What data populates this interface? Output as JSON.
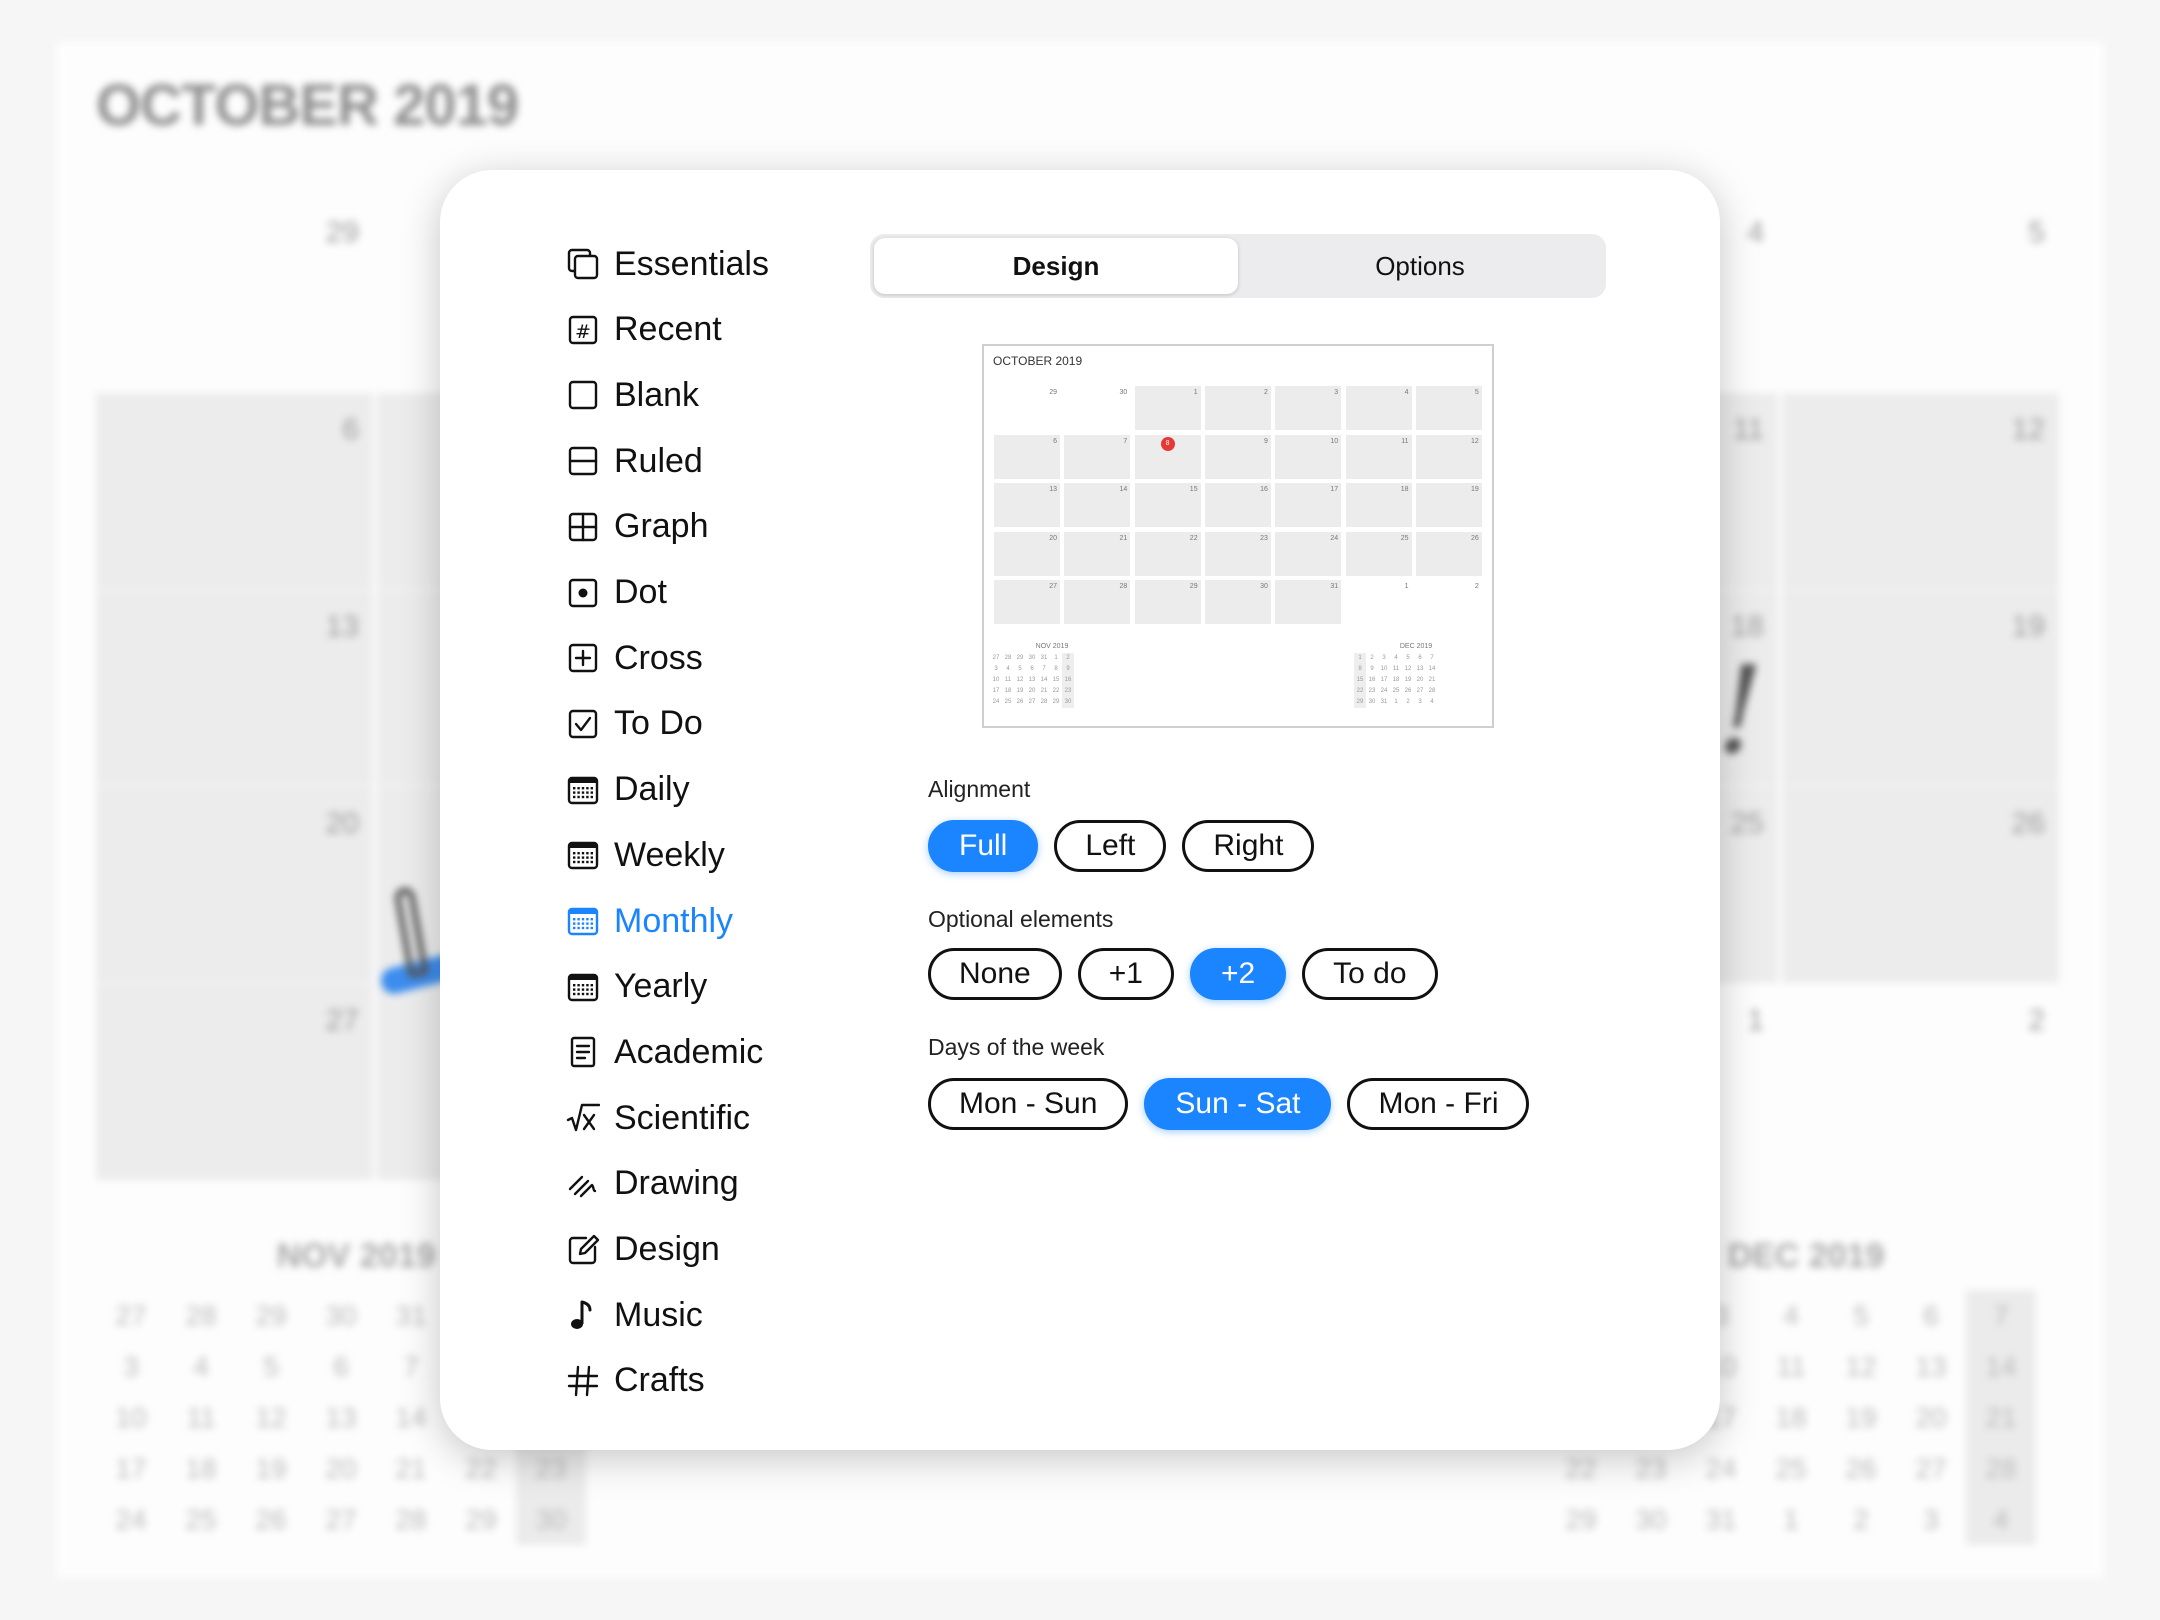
{
  "background": {
    "title": "OCTOBER 2019",
    "weeks": [
      [
        "29",
        "",
        "",
        "",
        "",
        "4",
        "5"
      ],
      [
        "6",
        "",
        "",
        "",
        "",
        "11",
        "12"
      ],
      [
        "13",
        "",
        "",
        "",
        "",
        "18",
        "19"
      ],
      [
        "20",
        "",
        "",
        "",
        "",
        "25",
        "26"
      ],
      [
        "27",
        "",
        "",
        "",
        "",
        "1",
        "2"
      ]
    ],
    "mini_left": {
      "title": "NOV 2019",
      "days": [
        "27",
        "28",
        "29",
        "30",
        "31",
        "",
        "",
        "3",
        "4",
        "5",
        "6",
        "7",
        "",
        "",
        "10",
        "11",
        "12",
        "13",
        "14",
        "",
        "",
        "17",
        "18",
        "19",
        "20",
        "21",
        "22",
        "23",
        "24",
        "25",
        "26",
        "27",
        "28",
        "29",
        "30"
      ]
    },
    "mini_right": {
      "title": "DEC 2019",
      "days": [
        "",
        "",
        "3",
        "4",
        "5",
        "6",
        "7",
        "",
        "",
        "10",
        "11",
        "12",
        "13",
        "14",
        "",
        "",
        "17",
        "18",
        "19",
        "20",
        "21",
        "22",
        "23",
        "24",
        "25",
        "26",
        "27",
        "28",
        "29",
        "30",
        "31",
        "1",
        "2",
        "3",
        "4"
      ]
    }
  },
  "sidebar": {
    "items": [
      {
        "label": "Essentials",
        "icon": "essentials-icon"
      },
      {
        "label": "Recent",
        "icon": "recent-icon"
      },
      {
        "label": "Blank",
        "icon": "blank-icon"
      },
      {
        "label": "Ruled",
        "icon": "ruled-icon"
      },
      {
        "label": "Graph",
        "icon": "graph-icon"
      },
      {
        "label": "Dot",
        "icon": "dot-icon"
      },
      {
        "label": "Cross",
        "icon": "cross-icon"
      },
      {
        "label": "To Do",
        "icon": "todo-icon"
      },
      {
        "label": "Daily",
        "icon": "calendar-icon"
      },
      {
        "label": "Weekly",
        "icon": "calendar-icon"
      },
      {
        "label": "Monthly",
        "icon": "calendar-icon"
      },
      {
        "label": "Yearly",
        "icon": "calendar-icon"
      },
      {
        "label": "Academic",
        "icon": "academic-icon"
      },
      {
        "label": "Scientific",
        "icon": "sqrt-icon"
      },
      {
        "label": "Drawing",
        "icon": "drawing-icon"
      },
      {
        "label": "Design",
        "icon": "design-icon"
      },
      {
        "label": "Music",
        "icon": "music-note-icon"
      },
      {
        "label": "Crafts",
        "icon": "hashtag-icon"
      }
    ],
    "selected": "Monthly"
  },
  "tabs": {
    "items": [
      "Design",
      "Options"
    ],
    "selected": "Design"
  },
  "preview": {
    "title": "OCTOBER 2019",
    "weeks": [
      [
        "29",
        "30",
        "1",
        "2",
        "3",
        "4",
        "5"
      ],
      [
        "6",
        "7",
        "8",
        "9",
        "10",
        "11",
        "12"
      ],
      [
        "13",
        "14",
        "15",
        "16",
        "17",
        "18",
        "19"
      ],
      [
        "20",
        "21",
        "22",
        "23",
        "24",
        "25",
        "26"
      ],
      [
        "27",
        "28",
        "29",
        "30",
        "31",
        "1",
        "2"
      ]
    ],
    "today": "8",
    "mini_left": {
      "title": "NOV 2019",
      "days": [
        "27",
        "28",
        "29",
        "30",
        "31",
        "1",
        "2",
        "3",
        "4",
        "5",
        "6",
        "7",
        "8",
        "9",
        "10",
        "11",
        "12",
        "13",
        "14",
        "15",
        "16",
        "17",
        "18",
        "19",
        "20",
        "21",
        "22",
        "23",
        "24",
        "25",
        "26",
        "27",
        "28",
        "29",
        "30"
      ]
    },
    "mini_right": {
      "title": "DEC 2019",
      "days": [
        "1",
        "2",
        "3",
        "4",
        "5",
        "6",
        "7",
        "8",
        "9",
        "10",
        "11",
        "12",
        "13",
        "14",
        "15",
        "16",
        "17",
        "18",
        "19",
        "20",
        "21",
        "22",
        "23",
        "24",
        "25",
        "26",
        "27",
        "28",
        "29",
        "30",
        "31",
        "1",
        "2",
        "3",
        "4"
      ]
    }
  },
  "alignment": {
    "label": "Alignment",
    "options": [
      "Full",
      "Left",
      "Right"
    ],
    "selected": "Full"
  },
  "optional": {
    "label": "Optional elements",
    "options": [
      "None",
      "+1",
      "+2",
      "To do"
    ],
    "selected": "+2"
  },
  "days": {
    "label": "Days of the week",
    "options": [
      "Mon - Sun",
      "Sun - Sat",
      "Mon - Fri"
    ],
    "selected": "Sun - Sat"
  },
  "colors": {
    "accent": "#1a85ff",
    "today": "#e53935"
  }
}
